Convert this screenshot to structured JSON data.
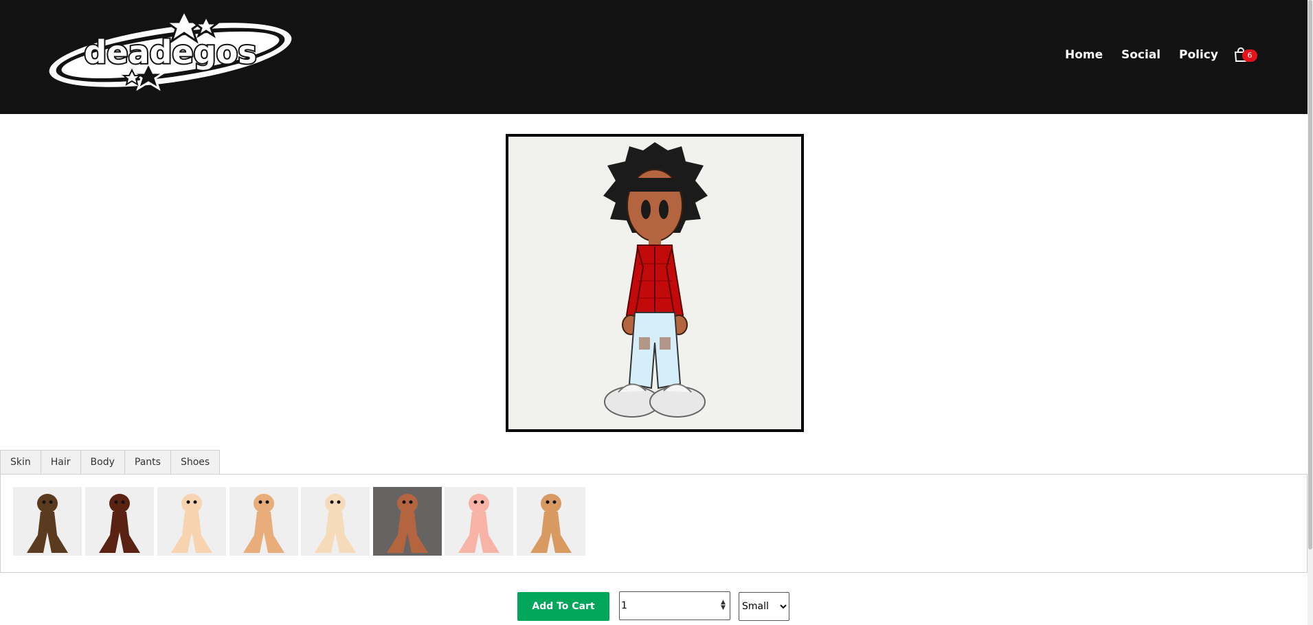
{
  "brand": {
    "logo_text": "deadegos"
  },
  "nav": {
    "items": [
      {
        "label": "Home"
      },
      {
        "label": "Social"
      },
      {
        "label": "Policy"
      }
    ],
    "cart_count": "6"
  },
  "customizer": {
    "tabs": [
      {
        "label": "Skin"
      },
      {
        "label": "Hair"
      },
      {
        "label": "Body"
      },
      {
        "label": "Pants"
      },
      {
        "label": "Shoes"
      }
    ],
    "active_tab": "Skin",
    "skin_options": [
      {
        "color": "#5b3b1f"
      },
      {
        "color": "#5a2212"
      },
      {
        "color": "#f7d3b0"
      },
      {
        "color": "#e9ad7b"
      },
      {
        "color": "#f6dbbb"
      },
      {
        "color": "#b4653f"
      },
      {
        "color": "#f6b3a6"
      },
      {
        "color": "#d89a61"
      }
    ],
    "selected_skin_index": 5
  },
  "purchase": {
    "add_to_cart_label": "Add To Cart",
    "quantity": "1",
    "size_selected": "Small",
    "size_options": [
      "Small"
    ]
  },
  "colors": {
    "header_bg": "#121212",
    "cart_badge": "#e5141b",
    "add_to_cart_bg": "#00a65a"
  }
}
